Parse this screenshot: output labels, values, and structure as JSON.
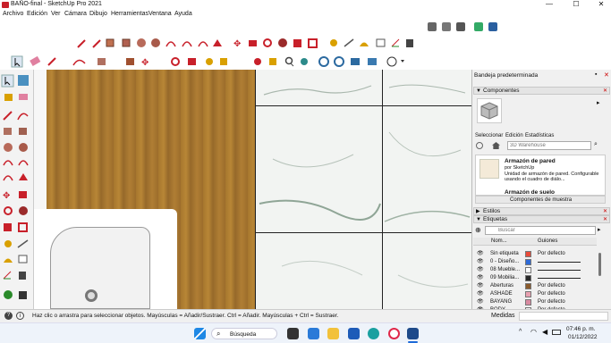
{
  "window": {
    "title": "BAÑO-final - SketchUp Pro 2021",
    "minimize": "—",
    "maximize": "☐",
    "close": "✕"
  },
  "menu": [
    "Archivo",
    "Edición",
    "Ver",
    "Cámara",
    "Dibujo",
    "Herramientas",
    "Ventana",
    "Ayuda"
  ],
  "tray": {
    "title": "Bandeja predeterminada",
    "pin": "▪",
    "close": "✕",
    "components": {
      "header": "Componentes",
      "tabs": [
        "Seleccionar",
        "Edición",
        "Estadísticas"
      ],
      "search_placeholder": "3D Warehouse",
      "item1_title": "Armazón de pared",
      "item1_author": "por SketchUp",
      "item1_desc": "Unidad de armazón de pared. Configurable usando el cuadro de diálo...",
      "item2_title": "Armazón de suelo",
      "sample_label": "Componentes de muestra"
    },
    "styles_header": "Estilos",
    "tags": {
      "header": "Etiquetas",
      "search_placeholder": "Buscar",
      "col_name": "Nom...",
      "col_guides": "Guiones",
      "rows": [
        {
          "name": "Sin etiqueta",
          "color": "#e84b3a",
          "guide": "Por defecto",
          "line": false
        },
        {
          "name": "0 - Diseño...",
          "color": "#2f6bd8",
          "guide": "",
          "line": true
        },
        {
          "name": "08 Mueble...",
          "color": "#ffffff",
          "guide": "",
          "line": true
        },
        {
          "name": "09 Mobilia...",
          "color": "#2a2a2a",
          "guide": "",
          "line": true
        },
        {
          "name": "Aberturas",
          "color": "#8a5a2b",
          "guide": "Por defecto",
          "line": false
        },
        {
          "name": "ASHADE",
          "color": "#e8a0b0",
          "guide": "Por defecto",
          "line": false
        },
        {
          "name": "BAYANG",
          "color": "#d88aa0",
          "guide": "Por defecto",
          "line": false
        },
        {
          "name": "BODY",
          "color": "#f0f0f0",
          "guide": "Por defecto",
          "line": false
        }
      ]
    }
  },
  "status": {
    "message": "Haz clic o arrastra para seleccionar objetos. Mayúsculas = Añadir/Sustraer. Ctrl = Añadir. Mayúsculas + Ctrl = Sustraer.",
    "measure_label": "Medidas"
  },
  "taskbar": {
    "search_label": "Búsqueda",
    "time": "07:46 p. m.",
    "date": "01/12/2022",
    "tray_caret": "^"
  },
  "colors": {
    "accent_red": "#c8202a",
    "tool_yellow": "#d9a000",
    "tool_teal": "#2c8a8a"
  }
}
